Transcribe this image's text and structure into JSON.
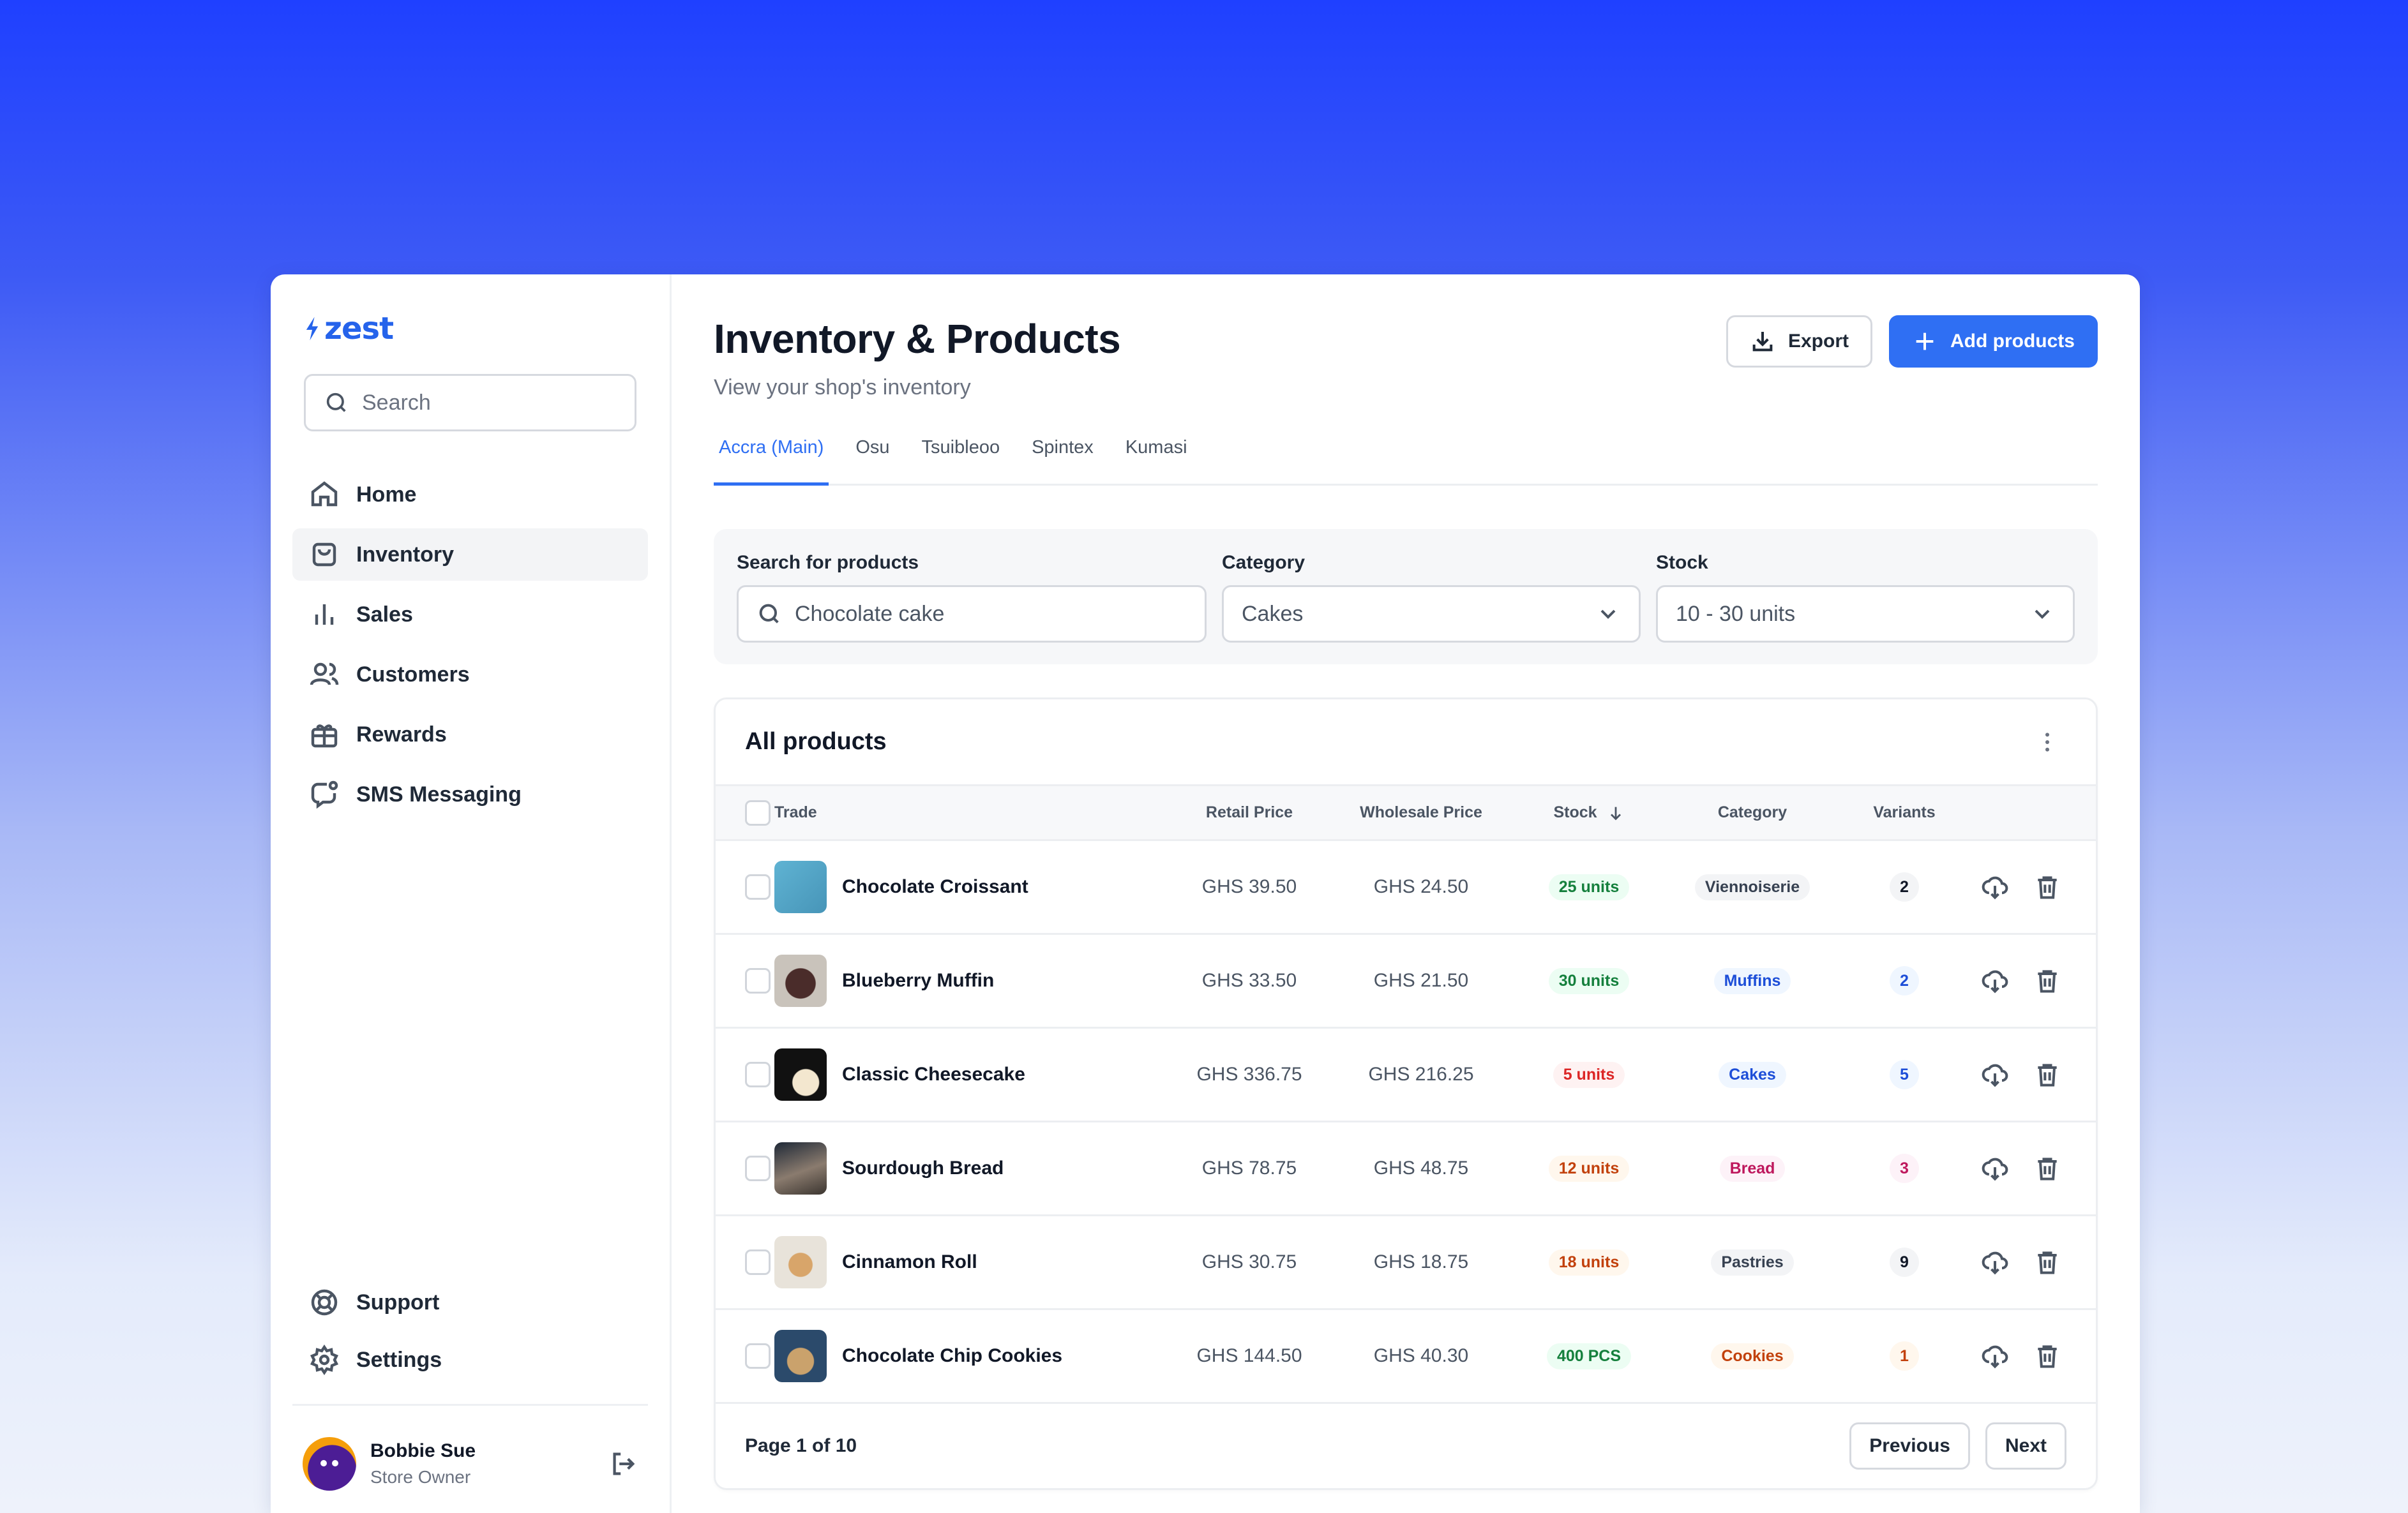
{
  "brand": {
    "name": "zest",
    "accent": "#2f6ff3"
  },
  "sidebar": {
    "search_placeholder": "Search",
    "items": [
      {
        "label": "Home",
        "icon": "home-icon"
      },
      {
        "label": "Inventory",
        "icon": "bag-icon",
        "active": true
      },
      {
        "label": "Sales",
        "icon": "bar-chart-icon"
      },
      {
        "label": "Customers",
        "icon": "users-icon"
      },
      {
        "label": "Rewards",
        "icon": "gift-icon"
      },
      {
        "label": "SMS Messaging",
        "icon": "message-icon"
      }
    ],
    "footer_items": [
      {
        "label": "Support",
        "icon": "lifebuoy-icon"
      },
      {
        "label": "Settings",
        "icon": "gear-icon"
      }
    ],
    "user": {
      "name": "Bobbie Sue",
      "role": "Store Owner"
    }
  },
  "header": {
    "title": "Inventory & Products",
    "subtitle": "View your shop's inventory",
    "export_label": "Export",
    "add_label": "Add products"
  },
  "tabs": [
    {
      "label": "Accra (Main)",
      "active": true
    },
    {
      "label": "Osu"
    },
    {
      "label": "Tsuibleoo"
    },
    {
      "label": "Spintex"
    },
    {
      "label": "Kumasi"
    }
  ],
  "filters": {
    "search_label": "Search for products",
    "search_value": "Chocolate cake",
    "category_label": "Category",
    "category_value": "Cakes",
    "stock_label": "Stock",
    "stock_value": "10 - 30 units"
  },
  "table": {
    "title": "All products",
    "columns": [
      "Trade",
      "Retail Price",
      "Wholesale Price",
      "Stock",
      "Category",
      "Variants"
    ],
    "rows": [
      {
        "name": "Chocolate Croissant",
        "retail": "GHS 39.50",
        "wholesale": "GHS 24.50",
        "stock": "25 units",
        "stock_status": "ok",
        "category": "Viennoiserie",
        "category_color": "gray",
        "variants": "2"
      },
      {
        "name": "Blueberry Muffin",
        "retail": "GHS 33.50",
        "wholesale": "GHS 21.50",
        "stock": "30 units",
        "stock_status": "ok",
        "category": "Muffins",
        "category_color": "blue",
        "variants": "2"
      },
      {
        "name": "Classic Cheesecake",
        "retail": "GHS 336.75",
        "wholesale": "GHS 216.25",
        "stock": "5 units",
        "stock_status": "low",
        "category": "Cakes",
        "category_color": "blue",
        "variants": "5"
      },
      {
        "name": "Sourdough Bread",
        "retail": "GHS 78.75",
        "wholesale": "GHS 48.75",
        "stock": "12 units",
        "stock_status": "warn",
        "category": "Bread",
        "category_color": "pink",
        "variants": "3"
      },
      {
        "name": "Cinnamon Roll",
        "retail": "GHS 30.75",
        "wholesale": "GHS 18.75",
        "stock": "18 units",
        "stock_status": "warn",
        "category": "Pastries",
        "category_color": "gray",
        "variants": "9"
      },
      {
        "name": "Chocolate Chip Cookies",
        "retail": "GHS 144.50",
        "wholesale": "GHS 40.30",
        "stock": "400 PCS",
        "stock_status": "ok",
        "category": "Cookies",
        "category_color": "orange",
        "variants": "1"
      }
    ],
    "page_text": "Page 1 of 10",
    "prev_label": "Previous",
    "next_label": "Next"
  }
}
